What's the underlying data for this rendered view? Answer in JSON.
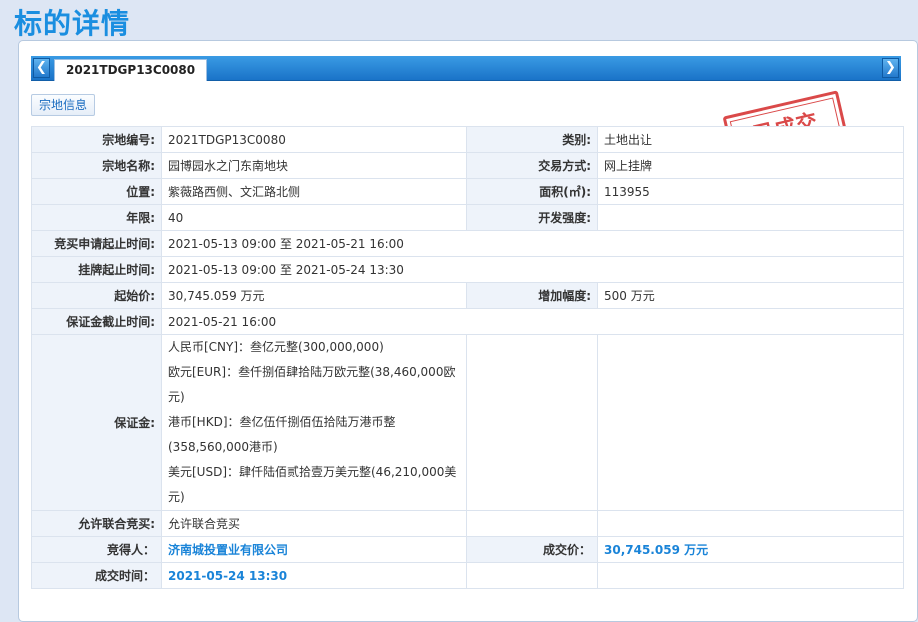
{
  "page_title": "标的详情",
  "tab": {
    "label": "2021TDGP13C0080"
  },
  "section_button": "宗地信息",
  "stamp": "已成交",
  "rows": {
    "parcel_no": {
      "label": "宗地编号:",
      "value": "2021TDGP13C0080"
    },
    "category": {
      "label": "类别:",
      "value": "土地出让"
    },
    "parcel_name": {
      "label": "宗地名称:",
      "value": "园博园水之门东南地块"
    },
    "trade_method": {
      "label": "交易方式:",
      "value": "网上挂牌"
    },
    "location": {
      "label": "位置:",
      "value": "紫薇路西侧、文汇路北侧"
    },
    "area": {
      "label": "面积(㎡):",
      "value": "113955"
    },
    "term": {
      "label": "年限:",
      "value": "40"
    },
    "dev_intensity": {
      "label": "开发强度:",
      "value": ""
    },
    "bid_apply_period": {
      "label": "竞买申请起止时间:",
      "value": "2021-05-13 09:00 至 2021-05-21 16:00"
    },
    "listing_period": {
      "label": "挂牌起止时间:",
      "value": "2021-05-13 09:00 至 2021-05-24 13:30"
    },
    "start_price": {
      "label": "起始价:",
      "value": "30,745.059 万元"
    },
    "increment": {
      "label": "增加幅度:",
      "value": "500 万元"
    },
    "deposit_deadline": {
      "label": "保证金截止时间:",
      "value": "2021-05-21 16:00"
    },
    "deposit": {
      "label": "保证金:",
      "lines": [
        "人民币[CNY]：叁亿元整(300,000,000)",
        "欧元[EUR]：叁仟捌佰肆拾陆万欧元整(38,460,000欧",
        "元)",
        "港币[HKD]：叁亿伍仟捌佰伍拾陆万港币整",
        "(358,560,000港币)",
        "美元[USD]：肆仟陆佰贰拾壹万美元整(46,210,000美",
        "元)"
      ]
    },
    "joint_bid": {
      "label": "允许联合竞买:",
      "value": "允许联合竞买"
    },
    "winner": {
      "label": "竞得人：",
      "value": "济南城投置业有限公司"
    },
    "deal_price": {
      "label": "成交价：",
      "value": "30,745.059 万元"
    },
    "deal_time": {
      "label": "成交时间：",
      "value": "2021-05-24 13:30"
    }
  }
}
